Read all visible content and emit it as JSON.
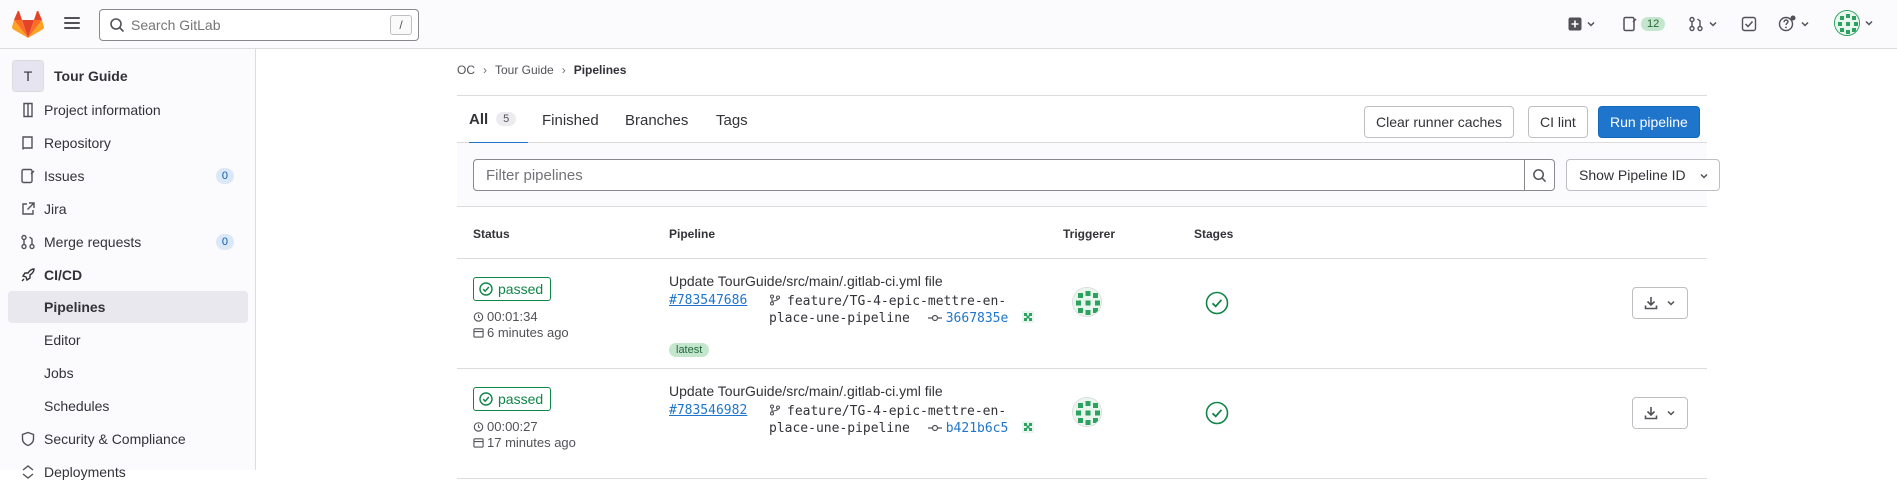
{
  "topbar": {
    "search_placeholder": "Search GitLab",
    "search_shortcut": "/",
    "merge_requests_count": "12"
  },
  "sidebar": {
    "project_initial": "T",
    "project_name": "Tour Guide",
    "items": [
      {
        "label": "Project information"
      },
      {
        "label": "Repository"
      },
      {
        "label": "Issues",
        "badge": "0"
      },
      {
        "label": "Jira"
      },
      {
        "label": "Merge requests",
        "badge": "0"
      },
      {
        "label": "CI/CD"
      },
      {
        "label": "Pipelines"
      },
      {
        "label": "Editor"
      },
      {
        "label": "Jobs"
      },
      {
        "label": "Schedules"
      },
      {
        "label": "Security & Compliance"
      },
      {
        "label": "Deployments"
      }
    ]
  },
  "breadcrumb": {
    "items": [
      "OC",
      "Tour Guide",
      "Pipelines"
    ]
  },
  "tabs": [
    {
      "label": "All",
      "count": "5"
    },
    {
      "label": "Finished"
    },
    {
      "label": "Branches"
    },
    {
      "label": "Tags"
    }
  ],
  "actions": {
    "clear_caches": "Clear runner caches",
    "ci_lint": "CI lint",
    "run_pipeline": "Run pipeline"
  },
  "filter": {
    "placeholder": "Filter pipelines",
    "show_id": "Show Pipeline ID"
  },
  "table": {
    "headers": [
      "Status",
      "Pipeline",
      "Triggerer",
      "Stages"
    ],
    "rows": [
      {
        "status": "passed",
        "duration": "00:01:34",
        "finished": "6 minutes ago",
        "title": "Update TourGuide/src/main/.gitlab-ci.yml file",
        "id": "#783547686",
        "branch_line1": "feature/TG-4-epic-mettre-en-",
        "branch_line2": "place-une-pipeline",
        "sha": "3667835e",
        "label": "latest"
      },
      {
        "status": "passed",
        "duration": "00:00:27",
        "finished": "17 minutes ago",
        "title": "Update TourGuide/src/main/.gitlab-ci.yml file",
        "id": "#783546982",
        "branch_line1": "feature/TG-4-epic-mettre-en-",
        "branch_line2": "place-une-pipeline",
        "sha": "b421b6c5"
      }
    ]
  },
  "colors": {
    "accent": "#1f75cb",
    "success": "#108548",
    "brand_orange": "#e24329"
  }
}
